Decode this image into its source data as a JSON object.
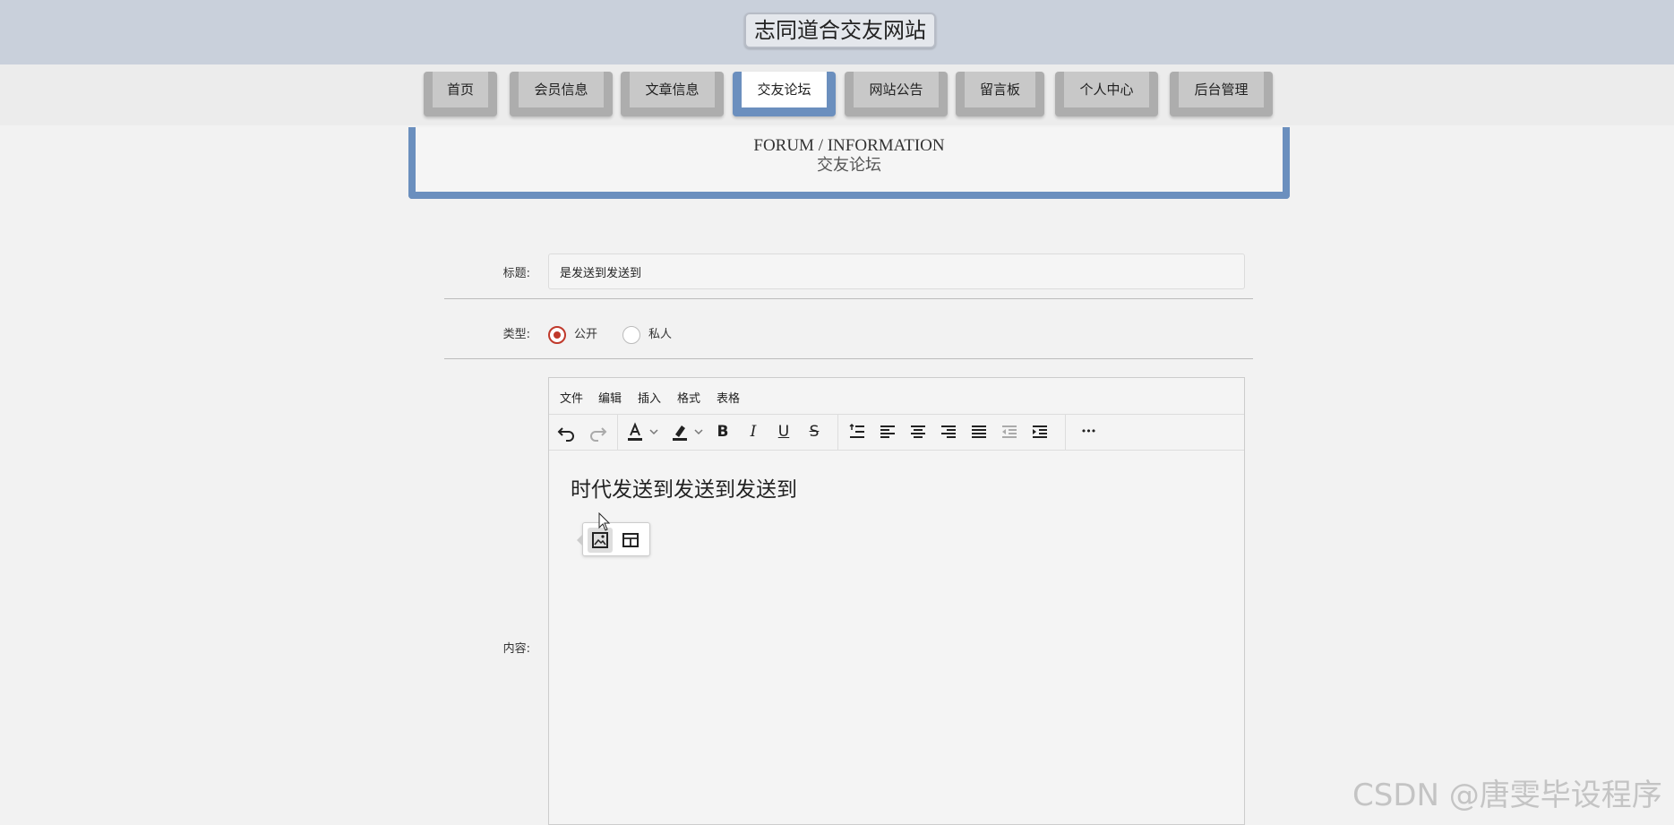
{
  "site": {
    "title": "志同道合交友网站"
  },
  "nav": {
    "items": [
      {
        "label": "首页"
      },
      {
        "label": "会员信息"
      },
      {
        "label": "文章信息"
      },
      {
        "label": "交友论坛"
      },
      {
        "label": "网站公告"
      },
      {
        "label": "留言板"
      },
      {
        "label": "个人中心"
      },
      {
        "label": "后台管理"
      }
    ],
    "active": "交友论坛"
  },
  "banner": {
    "en": "FORUM / INFORMATION",
    "cn": "交友论坛"
  },
  "form": {
    "title_label": "标题:",
    "title_value": "是发送到发送到",
    "type_label": "类型:",
    "type_options": [
      {
        "label": "公开",
        "checked": true
      },
      {
        "label": "私人",
        "checked": false
      }
    ],
    "content_label": "内容:"
  },
  "editor": {
    "menu": [
      "文件",
      "编辑",
      "插入",
      "格式",
      "表格"
    ],
    "toolbar_icons": [
      "undo-icon",
      "redo-icon",
      "text-color-icon",
      "chevron-down-icon",
      "highlight-color-icon",
      "chevron-down-icon",
      "bold-icon",
      "italic-icon",
      "underline-icon",
      "strikethrough-icon",
      "line-height-icon",
      "align-left-icon",
      "align-center-icon",
      "align-right-icon",
      "align-justify-icon",
      "outdent-icon",
      "indent-icon",
      "more-icon"
    ],
    "bold_glyph": "B",
    "italic_glyph": "I",
    "underline_glyph": "U",
    "strike_glyph": "S",
    "more_glyph": "•••",
    "content": "时代发送到发送到发送到",
    "quick_insert": [
      "image-icon",
      "table-icon"
    ]
  },
  "watermark": "CSDN @唐雯毕设程序",
  "colors": {
    "accent": "#6b8fbe",
    "radio_checked": "#c0392b",
    "topbar": "#c9d0db"
  }
}
